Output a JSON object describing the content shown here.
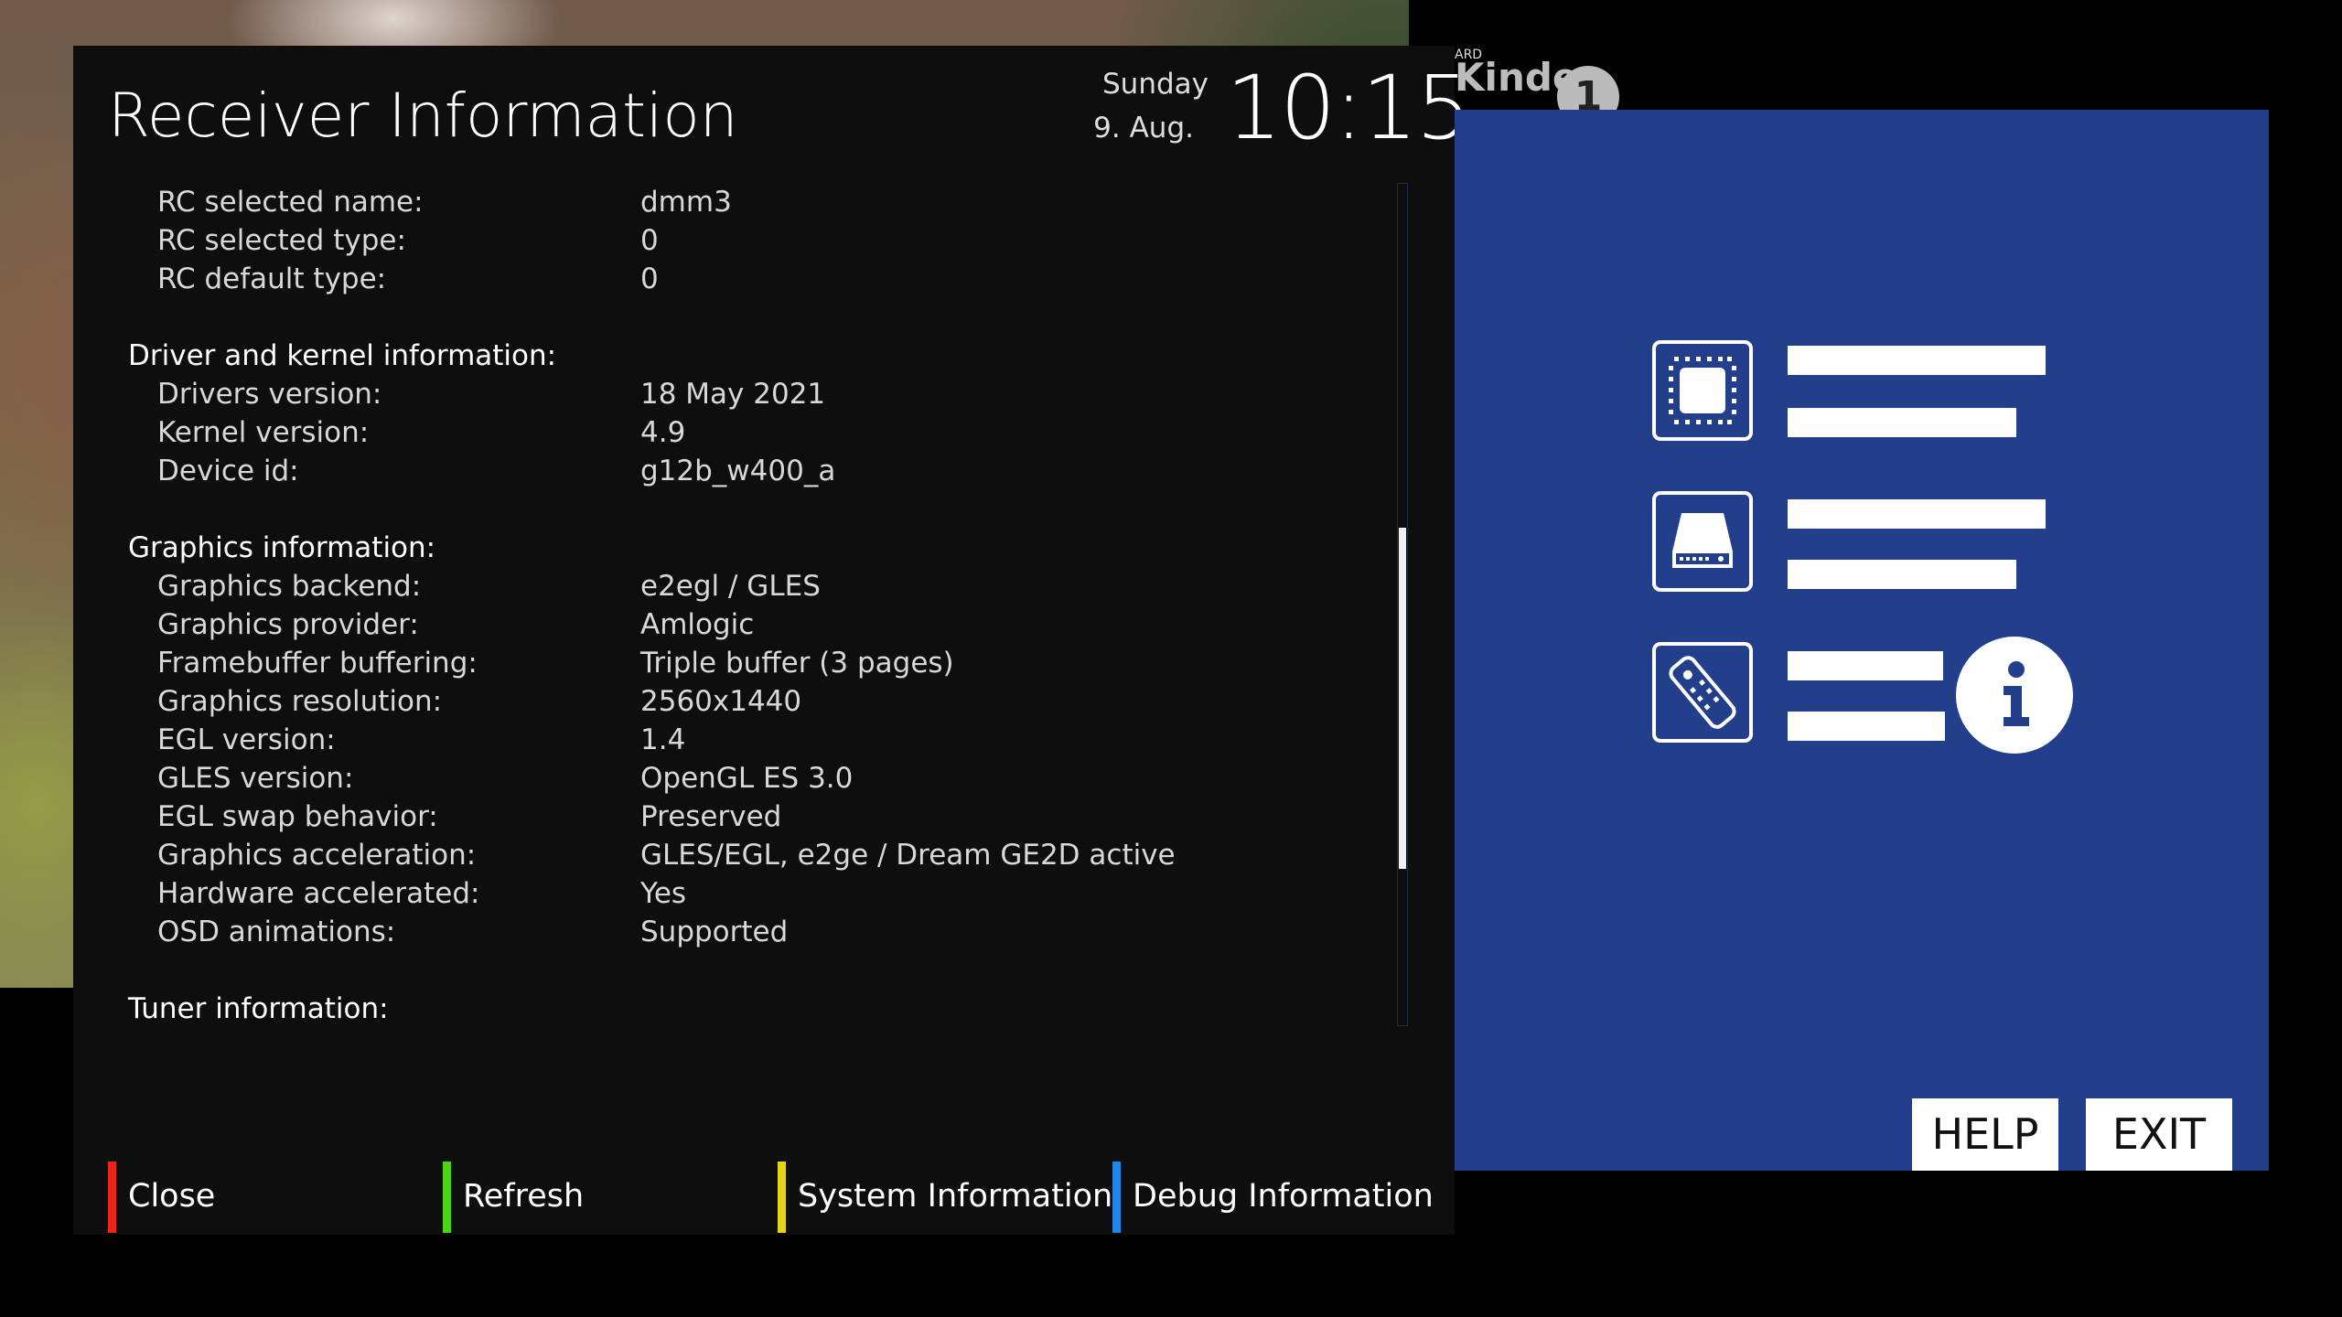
{
  "header": {
    "title": "Receiver Information",
    "day": "Sunday",
    "date": "9. Aug.",
    "time": "10:15"
  },
  "tv_logo": {
    "text": "Kinder",
    "small": "ARD",
    "channel": "1"
  },
  "rows_rc": [
    {
      "label": "RC selected name:",
      "value": "dmm3"
    },
    {
      "label": "RC selected type:",
      "value": "0"
    },
    {
      "label": "RC default type:",
      "value": "0"
    }
  ],
  "sections": {
    "driver": "Driver and kernel information:",
    "graphics": "Graphics information:",
    "tuner": "Tuner information:"
  },
  "rows_driver": [
    {
      "label": "Drivers version:",
      "value": "18 May 2021"
    },
    {
      "label": "Kernel version:",
      "value": "4.9"
    },
    {
      "label": "Device id:",
      "value": "g12b_w400_a"
    }
  ],
  "rows_graphics": [
    {
      "label": "Graphics backend:",
      "value": "e2egl / GLES"
    },
    {
      "label": "Graphics provider:",
      "value": "Amlogic"
    },
    {
      "label": "Framebuffer buffering:",
      "value": "Triple buffer (3 pages)"
    },
    {
      "label": "Graphics resolution:",
      "value": "2560x1440"
    },
    {
      "label": "EGL version:",
      "value": "1.4"
    },
    {
      "label": "GLES version:",
      "value": "OpenGL ES 3.0"
    },
    {
      "label": "EGL swap behavior:",
      "value": "Preserved"
    },
    {
      "label": "Graphics acceleration:",
      "value": "GLES/EGL, e2ge / Dream GE2D active"
    },
    {
      "label": "Hardware accelerated:",
      "value": "Yes"
    },
    {
      "label": "OSD animations:",
      "value": "Supported"
    }
  ],
  "footer": {
    "close": "Close",
    "refresh": "Refresh",
    "system": "System Information",
    "debug": "Debug Information",
    "colors": {
      "red": "#e8261c",
      "green": "#4ed218",
      "yellow": "#e6d41c",
      "blue": "#1e86e6"
    }
  },
  "side_buttons": {
    "help": "HELP",
    "exit": "EXIT"
  },
  "colors": {
    "panel_bg": "#0e0e0e",
    "blue_panel": "#233f8c"
  },
  "icons": [
    "cpu-chip-icon",
    "hard-drive-icon",
    "remote-control-icon",
    "info-icon"
  ]
}
